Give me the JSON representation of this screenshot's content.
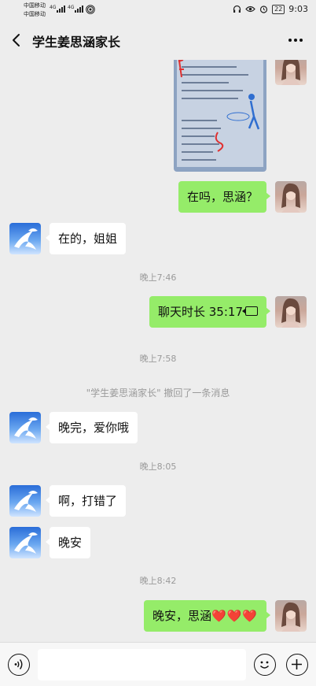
{
  "status_bar": {
    "carrier_1": "中国移动",
    "carrier_2": "中国移动",
    "network_1": "4G",
    "network_2": "4G",
    "battery": "22",
    "time": "9:03"
  },
  "nav": {
    "back_icon": "chevron-left-icon",
    "title": "学生姜思涵家长",
    "more_icon": "more-dots-icon"
  },
  "messages": [
    {
      "type": "image",
      "side": "right"
    },
    {
      "type": "text",
      "side": "right",
      "text": "在吗，思涵？"
    },
    {
      "type": "text",
      "side": "left",
      "text": "在的，姐姐"
    },
    {
      "type": "time",
      "text": "晚上7:46"
    },
    {
      "type": "call",
      "side": "right",
      "text": "聊天时长 35:17",
      "icon": "video-call-icon"
    },
    {
      "type": "time",
      "text": "晚上7:58"
    },
    {
      "type": "recall",
      "text": "\"学生姜思涵家长\" 撤回了一条消息"
    },
    {
      "type": "text",
      "side": "left",
      "text": "晚完，爱你哦"
    },
    {
      "type": "time",
      "text": "晚上8:05"
    },
    {
      "type": "text",
      "side": "left",
      "text": "啊，打错了"
    },
    {
      "type": "text",
      "side": "left",
      "text": "晚安"
    },
    {
      "type": "time",
      "text": "晚上8:42"
    },
    {
      "type": "text",
      "side": "right",
      "text": "晚安，思涵",
      "emoji": "❤️❤️❤️"
    }
  ],
  "input_bar": {
    "voice_icon": "voice-icon",
    "emoji_icon": "emoji-icon",
    "plus_icon": "plus-icon"
  },
  "colors": {
    "background": "#ededed",
    "bubble_self": "#95ec69",
    "bubble_other": "#ffffff",
    "muted_text": "#9a9a9a"
  }
}
